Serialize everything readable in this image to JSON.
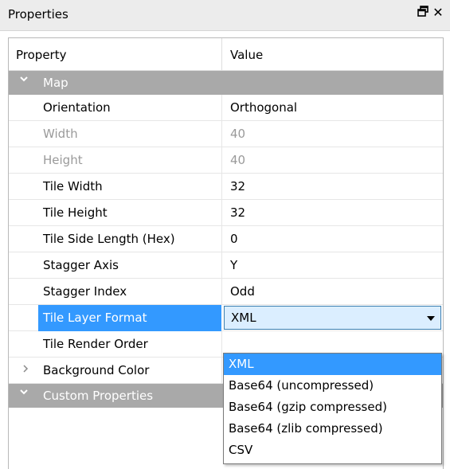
{
  "window": {
    "title": "Properties",
    "float_icon": "🗗",
    "close_icon": "✕"
  },
  "header": {
    "property_label": "Property",
    "value_label": "Value"
  },
  "groups": {
    "map": "Map",
    "custom": "Custom Properties"
  },
  "rows": [
    {
      "name": "Orientation",
      "value": "Orthogonal"
    },
    {
      "name": "Width",
      "value": "40"
    },
    {
      "name": "Height",
      "value": "40"
    },
    {
      "name": "Tile Width",
      "value": "32"
    },
    {
      "name": "Tile Height",
      "value": "32"
    },
    {
      "name": "Tile Side Length (Hex)",
      "value": "0"
    },
    {
      "name": "Stagger Axis",
      "value": "Y"
    },
    {
      "name": "Stagger Index",
      "value": "Odd"
    },
    {
      "name": "Tile Layer Format",
      "value": "XML"
    },
    {
      "name": "Tile Render Order",
      "value": ""
    },
    {
      "name": "Background Color",
      "value": ""
    }
  ],
  "dropdown": {
    "options": [
      "XML",
      "Base64 (uncompressed)",
      "Base64 (gzip compressed)",
      "Base64 (zlib compressed)",
      "CSV"
    ]
  },
  "colors": {
    "selection": "#3399ff",
    "group_bg": "#a9a9a9",
    "combo_bg": "#dbeeff"
  }
}
